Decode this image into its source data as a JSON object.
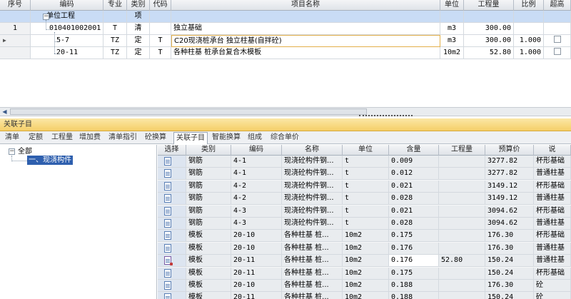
{
  "top_grid": {
    "columns": [
      "序号",
      "编码",
      "专业",
      "类别",
      "代码",
      "项目名称",
      "单位",
      "工程量",
      "比例",
      "超高"
    ],
    "rows": [
      {
        "seq": "",
        "code": "单位工程",
        "spec": "",
        "cat": "项",
        "daima": "",
        "name": "",
        "unit": "",
        "qty": "",
        "ratio": "",
        "check": false
      },
      {
        "seq": "1",
        "code": "010401002001",
        "spec": "T",
        "cat": "清",
        "daima": "",
        "name": "独立基础",
        "unit": "m3",
        "qty": "300.00",
        "ratio": "",
        "check": false
      },
      {
        "seq": "",
        "code": "5-7",
        "spec": "TZ",
        "cat": "定",
        "daima": "T",
        "name": "C20现浇桩承台 独立柱基(自拌砼)",
        "unit": "m3",
        "qty": "300.00",
        "ratio": "1.000",
        "check": false
      },
      {
        "seq": "",
        "code": "20-11",
        "spec": "TZ",
        "cat": "定",
        "daima": "T",
        "name": "各种柱基 桩承台复合木模板",
        "unit": "10m2",
        "qty": "52.80",
        "ratio": "1.000",
        "check": false
      }
    ]
  },
  "panel": {
    "title": "关联子目"
  },
  "tabs": [
    "清单",
    "定额",
    "工程量",
    "增加费",
    "清单指引",
    "砼换算",
    "关联子目",
    "智能换算",
    "组成",
    "综合单价"
  ],
  "active_tab": "关联子目",
  "tree": {
    "root": "全部",
    "child": "一、现浇构件"
  },
  "bottom_grid": {
    "columns": [
      "选择",
      "类别",
      "编码",
      "名称",
      "单位",
      "含量",
      "工程量",
      "预算价",
      "说"
    ],
    "rows": [
      {
        "cat": "钢筋",
        "code": "4-1",
        "name": "现浇砼构件钢...",
        "unit": "t",
        "content": "0.009",
        "qty": "",
        "price": "3277.82",
        "desc": "杯形基础",
        "edit": false
      },
      {
        "cat": "钢筋",
        "code": "4-1",
        "name": "现浇砼构件钢...",
        "unit": "t",
        "content": "0.012",
        "qty": "",
        "price": "3277.82",
        "desc": "普通柱基",
        "edit": false
      },
      {
        "cat": "钢筋",
        "code": "4-2",
        "name": "现浇砼构件钢...",
        "unit": "t",
        "content": "0.021",
        "qty": "",
        "price": "3149.12",
        "desc": "杯形基础",
        "edit": false
      },
      {
        "cat": "钢筋",
        "code": "4-2",
        "name": "现浇砼构件钢...",
        "unit": "t",
        "content": "0.028",
        "qty": "",
        "price": "3149.12",
        "desc": "普通柱基",
        "edit": false
      },
      {
        "cat": "钢筋",
        "code": "4-3",
        "name": "现浇砼构件钢...",
        "unit": "t",
        "content": "0.021",
        "qty": "",
        "price": "3094.62",
        "desc": "杯形基础",
        "edit": false
      },
      {
        "cat": "钢筋",
        "code": "4-3",
        "name": "现浇砼构件钢...",
        "unit": "t",
        "content": "0.028",
        "qty": "",
        "price": "3094.62",
        "desc": "普通柱基",
        "edit": false
      },
      {
        "cat": "模板",
        "code": "20-10",
        "name": "各种柱基 桩...",
        "unit": "10m2",
        "content": "0.175",
        "qty": "",
        "price": "176.30",
        "desc": "杯形基础",
        "edit": false
      },
      {
        "cat": "模板",
        "code": "20-10",
        "name": "各种柱基 桩...",
        "unit": "10m2",
        "content": "0.176",
        "qty": "",
        "price": "176.30",
        "desc": "普通柱基",
        "edit": false
      },
      {
        "cat": "模板",
        "code": "20-11",
        "name": "各种柱基 桩...",
        "unit": "10m2",
        "content": "0.176",
        "qty": "52.80",
        "price": "150.24",
        "desc": "普通柱基",
        "edit": true
      },
      {
        "cat": "模板",
        "code": "20-11",
        "name": "各种柱基 桩...",
        "unit": "10m2",
        "content": "0.175",
        "qty": "",
        "price": "150.24",
        "desc": "杯形基础",
        "edit": false
      },
      {
        "cat": "模板",
        "code": "20-10",
        "name": "各种柱基 桩...",
        "unit": "10m2",
        "content": "0.188",
        "qty": "",
        "price": "176.30",
        "desc": "砼",
        "edit": false
      },
      {
        "cat": "模板",
        "code": "20-11",
        "name": "各种柱基 桩...",
        "unit": "10m2",
        "content": "0.188",
        "qty": "",
        "price": "150.24",
        "desc": "砼",
        "edit": false
      }
    ]
  },
  "colors": {
    "selected_row": "#c9dcf5",
    "panel_title_bg": "#f5cf68",
    "tree_selected": "#2e5fae"
  }
}
